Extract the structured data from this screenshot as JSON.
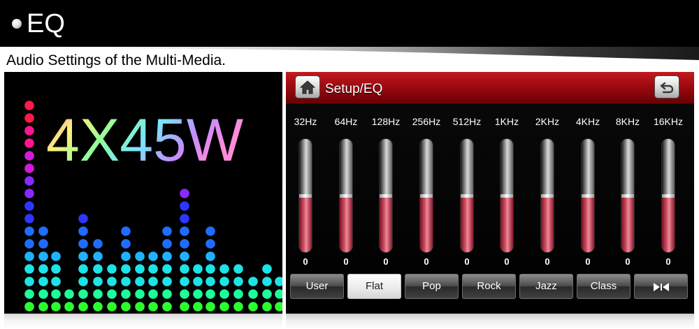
{
  "banner": {
    "title": "EQ"
  },
  "subtitle": "Audio Settings of the Multi-Media.",
  "promo": {
    "power_text": "4X45W"
  },
  "eq_screen": {
    "title": "Setup/EQ",
    "accent_color": "#a8111a",
    "home_icon": "home-icon",
    "back_icon": "back-arrow-icon",
    "bands": [
      {
        "freq": "32Hz",
        "value": "0",
        "level": 0.5
      },
      {
        "freq": "64Hz",
        "value": "0",
        "level": 0.5
      },
      {
        "freq": "128Hz",
        "value": "0",
        "level": 0.5
      },
      {
        "freq": "256Hz",
        "value": "0",
        "level": 0.5
      },
      {
        "freq": "512Hz",
        "value": "0",
        "level": 0.5
      },
      {
        "freq": "1KHz",
        "value": "0",
        "level": 0.5
      },
      {
        "freq": "2KHz",
        "value": "0",
        "level": 0.5
      },
      {
        "freq": "4KHz",
        "value": "0",
        "level": 0.5
      },
      {
        "freq": "8KHz",
        "value": "0",
        "level": 0.5
      },
      {
        "freq": "16KHz",
        "value": "0",
        "level": 0.5
      }
    ],
    "presets": [
      {
        "label": "User",
        "active": false
      },
      {
        "label": "Flat",
        "active": true
      },
      {
        "label": "Pop",
        "active": false
      },
      {
        "label": "Rock",
        "active": false
      },
      {
        "label": "Jazz",
        "active": false
      },
      {
        "label": "Class",
        "active": false
      }
    ],
    "balance_button_icon": "balance-fader-icon"
  }
}
